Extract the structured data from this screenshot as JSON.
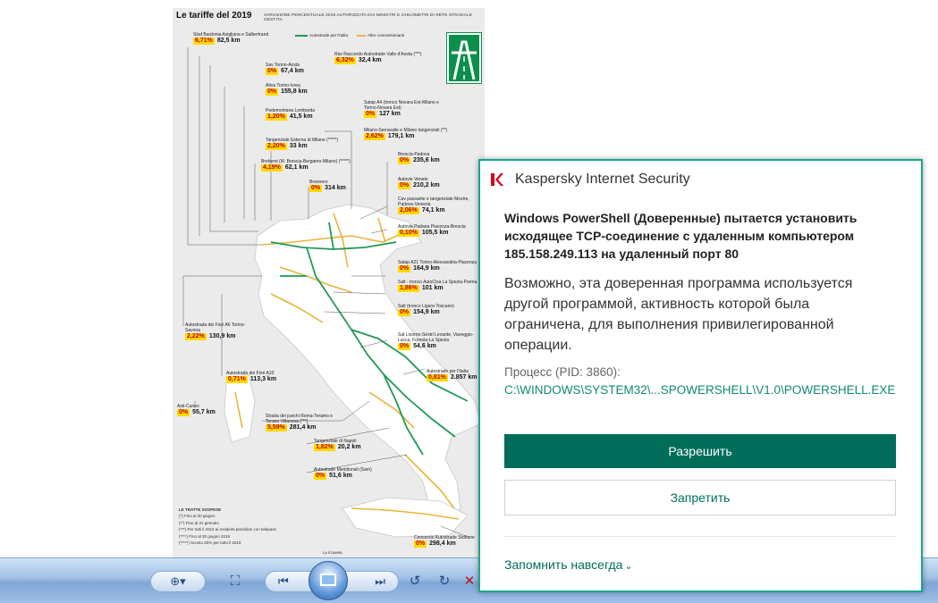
{
  "map": {
    "title": "Le tariffe del 2019",
    "subtitle": "VARIAZIONE PERCENTUALE 2019 AUTORIZZATA DAI MINISTRI E CHILOMETRI DI RETE STRADALE GESTITA",
    "legend_autostrade": "Autostrade per l'Italia",
    "legend_altre": "Altre concessionarie",
    "colors": {
      "autostrade": "#1f9a57",
      "altre": "#e8b53a",
      "tag_bg": "#ffd900",
      "tag_text": "#c0000c",
      "sign": "#0c8f4b"
    },
    "labels": [
      {
        "name": "Sitaf Bardonia Avigliana e Salbertrand",
        "pct": "6,71%",
        "km": "82,5 km"
      },
      {
        "name": "Rav Raccordo Autostrade Valle d'Aosta (***)",
        "pct": "6,32%",
        "km": "32,4 km"
      },
      {
        "name": "Sav Torino-Aosta",
        "pct": "0%",
        "km": "67,4 km"
      },
      {
        "name": "Ativa Torino-Ivrea",
        "pct": "0%",
        "km": "155,8 km"
      },
      {
        "name": "Satap A4 (tronco Novara Est-Milano e Torino-Novara Est)",
        "pct": "0%",
        "km": "127 km"
      },
      {
        "name": "Pedemontana Lombarda",
        "pct": "1,20%",
        "km": "41,5 km"
      },
      {
        "name": "Milano-Serravalle e Milano tangenziali (**)",
        "pct": "2,62%",
        "km": "179,1 km"
      },
      {
        "name": "Tangenziale Esterna di Milano (*****)",
        "pct": "2,20%",
        "km": "33 km"
      },
      {
        "name": "Brescia-Padova",
        "pct": "0%",
        "km": "235,6 km"
      },
      {
        "name": "Brebemi (M. Brescia-Bergamo-Milano) (*****)",
        "pct": "4,19%",
        "km": "62,1 km"
      },
      {
        "name": "Brennero",
        "pct": "0%",
        "km": "314 km"
      },
      {
        "name": "Autovie Venete",
        "pct": "0%",
        "km": "210,2 km"
      },
      {
        "name": "Cav passante e tangenziale Mestre, Padova-Venezia",
        "pct": "2,06%",
        "km": "74,1 km"
      },
      {
        "name": "Autovia Padana Piacenza-Brescia",
        "pct": "0,10%",
        "km": "105,5 km"
      },
      {
        "name": "Satap A21 Torino-Alessandria-Piacenza",
        "pct": "0%",
        "km": "164,9 km"
      },
      {
        "name": "Salt - tronco AutoCisa La Spezia-Parma",
        "pct": "1,86%",
        "km": "101 km"
      },
      {
        "name": "Salt (tronco Ligure-Toscano)",
        "pct": "0%",
        "km": "154,9 km"
      },
      {
        "name": "Autostrada dei Fiori A6 Torino-Savona",
        "pct": "2,22%",
        "km": "130,9 km"
      },
      {
        "name": "Sat Livorno-Sestri Levante, Viareggio-Lucca, Fornola-La Spezia",
        "pct": "0%",
        "km": "54,6 km"
      },
      {
        "name": "Autostrade per l'Italia",
        "pct": "0,81%",
        "km": "2.857 km"
      },
      {
        "name": "Autostrada dei Fiori A10",
        "pct": "0,71%",
        "km": "113,3 km"
      },
      {
        "name": "Asti-Cuneo",
        "pct": "0%",
        "km": "55,7 km"
      },
      {
        "name": "Strada dei parchi Roma-Teramo e Torano Villanova (***)",
        "pct": "5,59%",
        "km": "281,4 km"
      },
      {
        "name": "Tangenziale di Napoli",
        "pct": "1,82%",
        "km": "20,2 km"
      },
      {
        "name": "Autostrade Meridionali (Sam)",
        "pct": "0%",
        "km": "51,6 km"
      },
      {
        "name": "Consorzio Autostrade Siciliane",
        "pct": "0%",
        "km": "298,4 km"
      }
    ],
    "suspended_title": "LE TRATTE SOSPESE",
    "suspended_notes": [
      "(*) Fino al 30 giugno",
      "(**) Fino al 31 gennaio",
      "(***) Per tutti il 2019 ai residenti pendolari con telepass",
      "(****) Fino al 30 giugno 2019",
      "(*****) Sconto 20% per tutto il 2019"
    ],
    "credit": "LA STAMPA"
  },
  "taskbar": {
    "icons": [
      "zoom-icon",
      "fit-icon",
      "prev-icon",
      "play-slideshow-icon",
      "next-icon",
      "rotate-left-icon",
      "rotate-right-icon",
      "delete-icon"
    ]
  },
  "dialog": {
    "app_title": "Kaspersky Internet Security",
    "headline": "Windows PowerShell (Доверенные) пытается установить исходящее TCP-соединение с удаленным компьютером 185.158.249.113 на удаленный порт 80",
    "body": "Возможно, эта доверенная программа используется другой программой, активность которой была ограничена, для выполнения привилегированной операции.",
    "process_label": "Процесс (PID: 3860):",
    "process_path": "C:\\WINDOWS\\SYSTEM32\\...SPOWERSHELL\\V1.0\\POWERSHELL.EXE",
    "allow_label": "Разрешить",
    "deny_label": "Запретить",
    "remember_label": "Запомнить навсегда",
    "colors": {
      "accent": "#006d5b",
      "border": "#1aa68c",
      "logo": "#d6001c"
    }
  }
}
